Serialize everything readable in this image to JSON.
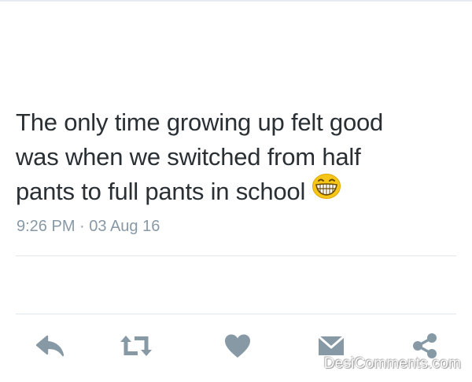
{
  "tweet": {
    "lines": [
      "The only time growing up felt good",
      "was when we switched from half",
      "pants to full pants in school"
    ],
    "emoji": "grinning-face-emoji",
    "timestamp": "9:26 PM · 03 Aug 16"
  },
  "actions": [
    {
      "icon": "reply-icon"
    },
    {
      "icon": "retweet-icon"
    },
    {
      "icon": "heart-icon"
    },
    {
      "icon": "message-icon"
    },
    {
      "icon": "share-icon"
    }
  ],
  "watermark": "DesiComments.com",
  "colors": {
    "text": "#292f33",
    "meta": "#8899a6",
    "icon": "#8899a6",
    "divider": "#e1e8ed",
    "emoji": "#f5c518"
  }
}
